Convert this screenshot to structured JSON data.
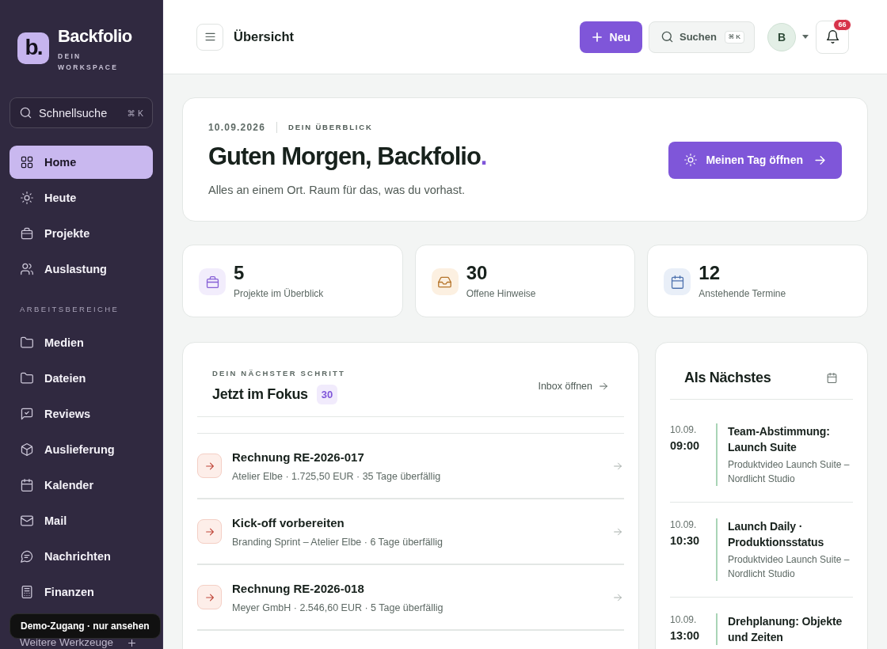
{
  "sidebar": {
    "logo_mark": "b.",
    "brand": "Backfolio",
    "tagline": "DEIN WORKSPACE",
    "quick_search": {
      "label": "Schnellsuche",
      "shortcut": "⌘ K"
    },
    "items": [
      {
        "label": "Home",
        "selected": true
      },
      {
        "label": "Heute",
        "selected": false
      },
      {
        "label": "Projekte",
        "selected": false
      },
      {
        "label": "Auslastung",
        "selected": false
      }
    ],
    "section_label": "ARBEITSBEREICHE",
    "workspace_items": [
      {
        "label": "Medien",
        "selected": false
      },
      {
        "label": "Dateien",
        "selected": false
      },
      {
        "label": "Reviews",
        "selected": false
      },
      {
        "label": "Auslieferung",
        "selected": false
      },
      {
        "label": "Kalender",
        "selected": false
      },
      {
        "label": "Mail",
        "selected": false
      },
      {
        "label": "Nachrichten",
        "selected": false
      },
      {
        "label": "Finanzen",
        "selected": false
      }
    ],
    "more_tools": "Weitere Werkzeuge",
    "tooltip": "Demo-Zugang · nur ansehen"
  },
  "header": {
    "title": "Übersicht",
    "new_button": "Neu",
    "search_button": "Suchen",
    "search_shortcut": "⌘ K",
    "avatar_initial": "B",
    "notification_count": "66"
  },
  "hero": {
    "date": "10.09.2026",
    "eyebrow": "DEIN ÜBERBLICK",
    "greeting": "Guten Morgen, Backfolio",
    "greeting_end": ".",
    "subtitle": "Alles an einem Ort. Raum für das, was du vorhast.",
    "button": "Meinen Tag öffnen"
  },
  "stats": [
    {
      "kind": "projects",
      "value": "5",
      "label": "Projekte im Überblick"
    },
    {
      "kind": "notices",
      "value": "30",
      "label": "Offene Hinweise"
    },
    {
      "kind": "appointments",
      "value": "12",
      "label": "Anstehende Termine"
    }
  ],
  "focus": {
    "eyebrow": "DEIN NÄCHSTER SCHRITT",
    "title": "Jetzt im Fokus",
    "count": "30",
    "link": "Inbox öffnen",
    "items": [
      {
        "title": "Rechnung RE-2026-017",
        "meta": "Atelier Elbe · 1.725,50 EUR · 35 Tage überfällig"
      },
      {
        "title": "Kick-off vorbereiten",
        "meta": "Branding Sprint – Atelier Elbe · 6 Tage überfällig"
      },
      {
        "title": "Rechnung RE-2026-018",
        "meta": "Meyer GmbH · 2.546,60 EUR · 5 Tage überfällig"
      }
    ]
  },
  "upcoming": {
    "title": "Als Nächstes",
    "events": [
      {
        "date": "10.09.",
        "time": "09:00",
        "title": "Team-Abstimmung: Launch Suite",
        "subtitle": "Produktvideo Launch Suite – Nordlicht Studio"
      },
      {
        "date": "10.09.",
        "time": "10:30",
        "title": "Launch Daily · Produktionsstatus",
        "subtitle": "Produktvideo Launch Suite – Nordlicht Studio"
      },
      {
        "date": "10.09.",
        "time": "13:00",
        "title": "Drehplanung: Objekte und Zeiten"
      }
    ]
  }
}
